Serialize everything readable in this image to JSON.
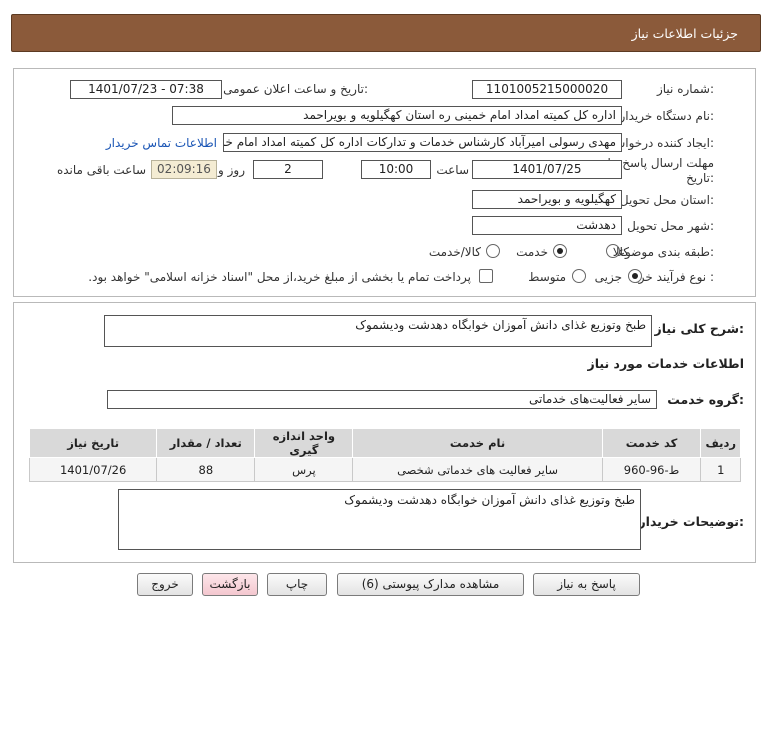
{
  "header": {
    "title": "جزئیات اطلاعات نیاز"
  },
  "fields": {
    "need_number_label": "شماره نیاز:",
    "need_number": "1101005215000020",
    "announce_label": "تاریخ و ساعت اعلان عمومی:",
    "announce_value": "1401/07/23 - 07:38",
    "buyer_org_label": "نام دستگاه خریدار:",
    "buyer_org": "اداره کل کمیته امداد امام خمینی  ره  استان کهگیلویه و بویراحمد",
    "creator_label": "ایجاد کننده درخواست:",
    "creator": "مهدی رسولی امیرآباد کارشناس خدمات و تدارکات اداره کل کمیته امداد امام خمینی",
    "contact_link": "اطلاعات تماس خریدار",
    "deadline_label": "مهلت ارسال پاسخ: تا تاریخ:",
    "deadline_date": "1401/07/25",
    "time_label": "ساعت",
    "deadline_time": "10:00",
    "days_value": "2",
    "days_label": "روز و",
    "remaining_time": "02:09:16",
    "remaining_label": "ساعت باقی مانده",
    "province_label": "استان محل تحویل:",
    "province": "کهگیلویه و بویراحمد",
    "city_label": "شهر محل تحویل:",
    "city": "دهدشت",
    "category_label": "طبقه بندی موضوعی:",
    "category_options": [
      "کالا",
      "خدمت",
      "کالا/خدمت"
    ],
    "category_selected": "خدمت",
    "process_label": "نوع فرآیند خرید :",
    "process_options": [
      "جزیی",
      "متوسط"
    ],
    "process_selected": "جزیی",
    "payment_note": "پرداخت تمام یا بخشی از مبلغ خرید،از محل \"اسناد خزانه اسلامی\" خواهد بود."
  },
  "summary": {
    "label": "شرح کلی نیاز:",
    "value": "طبخ وتوزیع غذای دانش آموزان خوابگاه دهدشت ودیشموک"
  },
  "services": {
    "section_title": "اطلاعات خدمات مورد نیاز",
    "group_label": "گروه خدمت:",
    "group_value": "سایر فعالیت‌های خدماتی",
    "table": {
      "headers": [
        "ردیف",
        "کد خدمت",
        "نام خدمت",
        "واحد اندازه گیری",
        "تعداد / مقدار",
        "تاریخ نیاز"
      ],
      "rows": [
        [
          "1",
          "ط-96-960",
          "سایر فعالیت های خدماتی شخصی",
          "پرس",
          "88",
          "1401/07/26"
        ]
      ]
    }
  },
  "buyer_notes": {
    "label": "توضیحات خریدار:",
    "value": "طبخ وتوزیع غذای دانش آموزان خوابگاه دهدشت ودیشموک"
  },
  "buttons": {
    "reply": "پاسخ به نیاز",
    "attachments": "مشاهده مدارک پیوستی (6)",
    "print": "چاپ",
    "back": "بازگشت",
    "exit": "خروج"
  },
  "colors": {
    "header_bg": "#8b5a3a",
    "link": "#1a55b5",
    "timer_bg": "#f4ecd3",
    "back_button_bg": "#f4c7cf"
  }
}
